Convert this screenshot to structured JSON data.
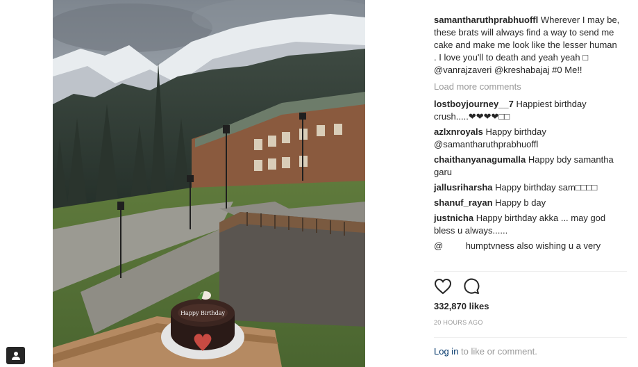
{
  "post": {
    "caption": {
      "username": "samantharuthprabhuoffl",
      "text": "Wherever I may be, these brats will always find a way to send me cake and make me look like the lesser human . I love you'll to death and yeah yeah □ @vanrajzaveri @kreshabajaj #0 Me!!"
    },
    "load_more": "Load more comments",
    "comments": [
      {
        "username": "lostboyjourney__7",
        "text": "Happiest birthday crush.....❤❤❤❤□□"
      },
      {
        "username": "azlxnroyals",
        "text": "Happy birthday @samantharuthprabhuoffl"
      },
      {
        "username": "chaithanyanagumalla",
        "text": "Happy bdy samantha garu"
      },
      {
        "username": "jallusriharsha",
        "text": "Happy birthday sam□□□□"
      },
      {
        "username": "shanuf_rayan",
        "text": "Happy b day"
      },
      {
        "username": "justnicha",
        "text": "Happy birthday akka ... may god bless u always......"
      }
    ],
    "partial_comment": "@         humptvness also wishing u a very",
    "likes": "332,870 likes",
    "timestamp": "20 HOURS AGO",
    "login": {
      "link": "Log in",
      "rest": " to like or comment."
    },
    "cake_text": "Happy Birthday"
  },
  "icons": {
    "like": "heart-icon",
    "comment": "comment-icon",
    "tag": "user-tag-icon"
  },
  "colors": {
    "link": "#003569",
    "muted": "#999999",
    "text": "#262626"
  }
}
